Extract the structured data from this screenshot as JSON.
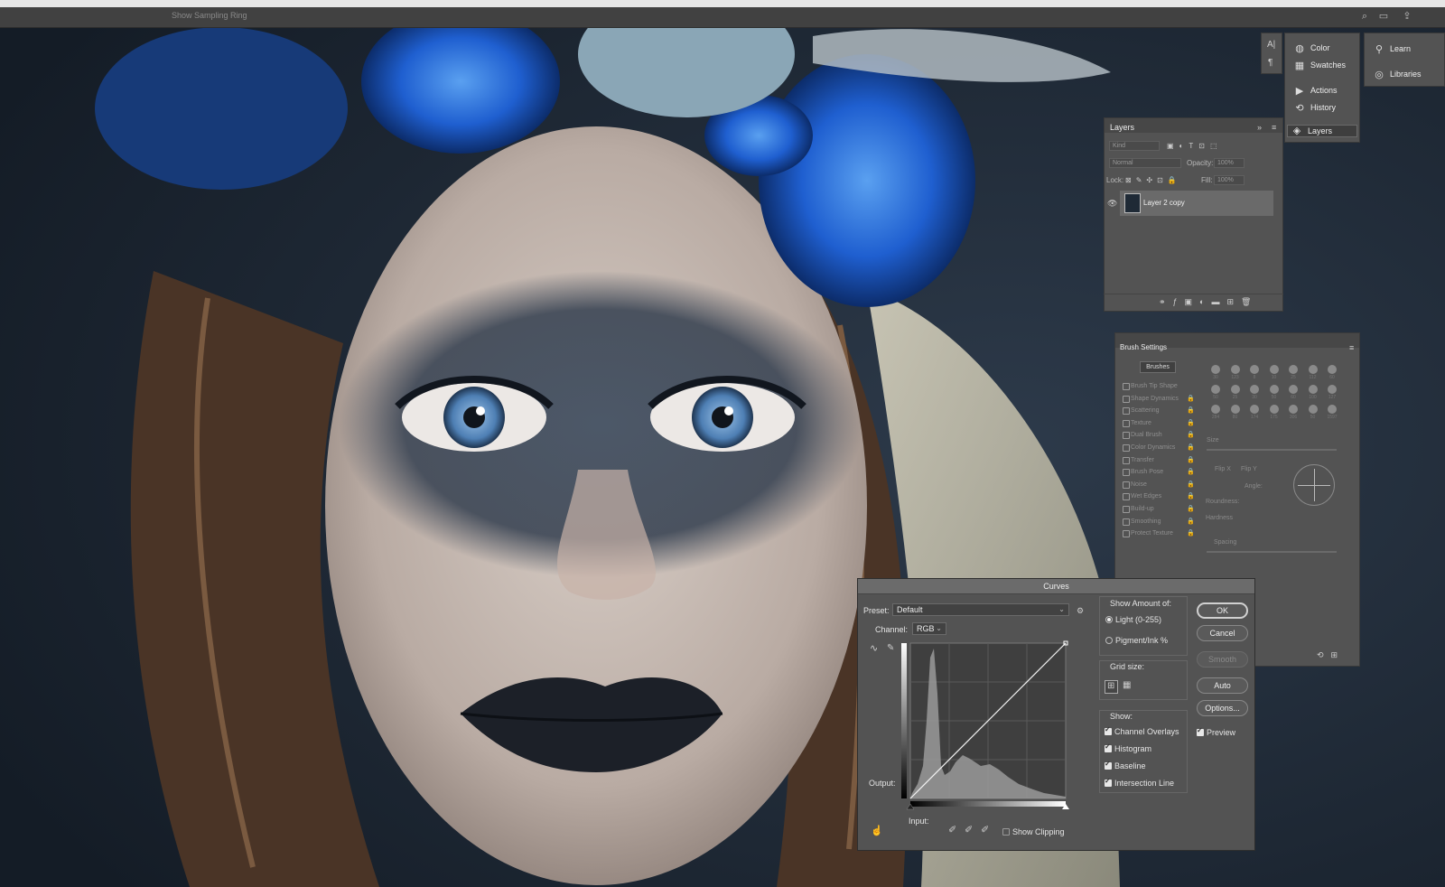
{
  "options_bar": {
    "hint": "Show Sampling Ring"
  },
  "dock": {
    "col1": [
      {
        "label": "Color",
        "icon": "color-wheel-icon"
      },
      {
        "label": "Swatches",
        "icon": "swatches-grid-icon"
      },
      {
        "label": "Actions",
        "icon": "play-icon"
      },
      {
        "label": "History",
        "icon": "history-icon"
      },
      {
        "label": "Layers",
        "icon": "layers-stack-icon"
      }
    ],
    "col2": [
      {
        "label": "Learn",
        "icon": "lightbulb-icon"
      },
      {
        "label": "Libraries",
        "icon": "libraries-icon"
      }
    ]
  },
  "layers_panel": {
    "tab": "Layers",
    "filter_placeholder": "Kind",
    "blend_mode": "Normal",
    "opacity_label": "Opacity:",
    "opacity_value": "100%",
    "lock_label": "Lock:",
    "fill_label": "Fill:",
    "fill_value": "100%",
    "layers": [
      {
        "name": "Layer 2 copy",
        "visible": true
      }
    ]
  },
  "brush_settings": {
    "tab": "Brush Settings",
    "brushes_button": "Brushes",
    "options": [
      "Brush Tip Shape",
      "Shape Dynamics",
      "Scattering",
      "Texture",
      "Dual Brush",
      "Color Dynamics",
      "Transfer",
      "Brush Pose",
      "Noise",
      "Wet Edges",
      "Build-up",
      "Smoothing",
      "Protect Texture"
    ],
    "size_label": "Size",
    "flip_x": "Flip X",
    "flip_y": "Flip Y",
    "angle_label": "Angle:",
    "roundness_label": "Roundness:",
    "hardness_label": "Hardness",
    "spacing_label": "Spacing",
    "brush_sizes": [
      "30",
      "123",
      "8",
      "10",
      "25",
      "112",
      "60",
      "50",
      "25",
      "30",
      "50",
      "60",
      "100",
      "127",
      "284",
      "80",
      "174",
      "175",
      "306",
      "50",
      "1597"
    ]
  },
  "curves": {
    "title": "Curves",
    "preset_label": "Preset:",
    "preset_value": "Default",
    "channel_label": "Channel:",
    "channel_value": "RGB",
    "output_label": "Output:",
    "input_label": "Input:",
    "show_clipping_label": "Show Clipping",
    "show_amount_label": "Show Amount of:",
    "light_label": "Light  (0-255)",
    "pigment_label": "Pigment/Ink %",
    "grid_size_label": "Grid size:",
    "show_label": "Show:",
    "channel_overlays": "Channel Overlays",
    "histogram": "Histogram",
    "baseline": "Baseline",
    "intersection_line": "Intersection Line",
    "preview": "Preview",
    "buttons": {
      "ok": "OK",
      "cancel": "Cancel",
      "smooth": "Smooth",
      "auto": "Auto",
      "options": "Options..."
    }
  }
}
